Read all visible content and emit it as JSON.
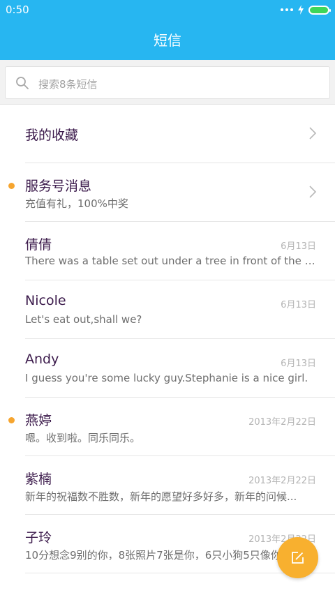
{
  "status_bar": {
    "time": "0:50"
  },
  "header": {
    "title": "短信"
  },
  "search": {
    "placeholder": "搜索8条短信"
  },
  "conversations": [
    {
      "name": "我的收藏",
      "preview": "",
      "date": "",
      "unread": false,
      "chevron": true
    },
    {
      "name": "服务号消息",
      "preview": "充值有礼，100%中奖",
      "date": "",
      "unread": true,
      "chevron": true
    },
    {
      "name": "倩倩",
      "preview": "There was a table set out under a tree in front of the ho...",
      "date": "6月13日",
      "unread": false,
      "chevron": false
    },
    {
      "name": "Nicole",
      "preview": "Let's eat out,shall we?",
      "date": "6月13日",
      "unread": false,
      "chevron": false
    },
    {
      "name": "Andy",
      "preview": "I guess you're some lucky guy.Stephanie is a nice girl.",
      "date": "6月13日",
      "unread": false,
      "chevron": false
    },
    {
      "name": "燕婷",
      "preview": "嗯。收到啦。同乐同乐。",
      "date": "2013年2月22日",
      "unread": true,
      "chevron": false
    },
    {
      "name": "紫楠",
      "preview": "新年的祝福数不胜数，新年的愿望好多好多，新年的问候...",
      "date": "2013年2月22日",
      "unread": false,
      "chevron": false
    },
    {
      "name": "子玲",
      "preview": "10分想念9别的你，8张照片7张是你，6只小狗5只像你...",
      "date": "2013年2月22日",
      "unread": false,
      "chevron": false
    }
  ],
  "colors": {
    "accent": "#27b6f1",
    "unread_dot": "#f6a52f",
    "fab": "#f8b02f"
  },
  "icons": {
    "search": "search-icon",
    "chevron": "chevron-right-icon",
    "fab": "compose-icon"
  }
}
